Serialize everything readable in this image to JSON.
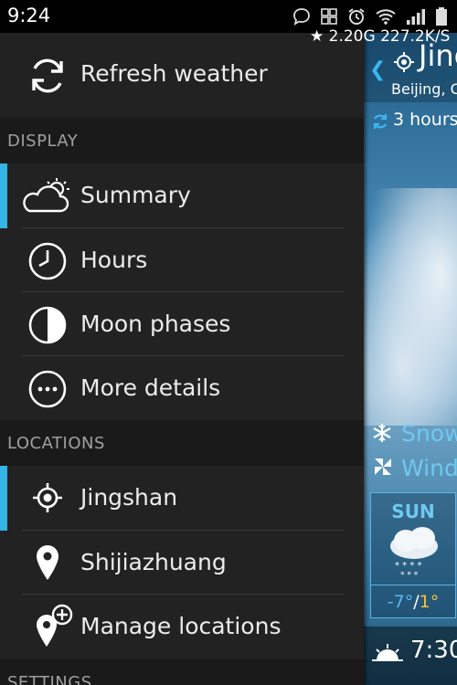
{
  "status_bar": {
    "time": "9:24",
    "icons": [
      "chat-icon",
      "apps-grid-icon",
      "alarm-icon",
      "wifi-icon",
      "signal-icon",
      "battery-icon"
    ]
  },
  "drawer": {
    "refresh_label": "Refresh weather",
    "sections": {
      "display": "DISPLAY",
      "locations": "LOCATIONS",
      "settings": "SETTINGS"
    },
    "display_items": [
      {
        "label": "Summary",
        "icon": "partly-cloudy-icon",
        "selected": true
      },
      {
        "label": "Hours",
        "icon": "clock-icon",
        "selected": false
      },
      {
        "label": "Moon phases",
        "icon": "moon-phase-icon",
        "selected": false
      },
      {
        "label": "More details",
        "icon": "more-details-icon",
        "selected": false
      }
    ],
    "location_items": [
      {
        "label": "Jingshan",
        "icon": "my-location-icon",
        "selected": true
      },
      {
        "label": "Shijiazhuang",
        "icon": "location-pin-icon",
        "selected": false
      },
      {
        "label": "Manage locations",
        "icon": "add-location-icon",
        "selected": false
      }
    ]
  },
  "background_app": {
    "speed_indicator": "★ 2.20G 227.2K/S",
    "city": "Jing",
    "country": "Beijing, C",
    "update_text": "3 hours",
    "condition": "Snow",
    "wind": "Wind",
    "forecast_day": {
      "name": "SUN",
      "low": "-7°",
      "separator": "/",
      "high": "1°"
    },
    "sunrise": "7:30"
  },
  "colors": {
    "accent": "#33b5e5",
    "drawer_bg": "#222222",
    "section_bg": "#1a1a1a",
    "temp_low": "#56b8ef",
    "temp_high": "#f2c34a"
  }
}
